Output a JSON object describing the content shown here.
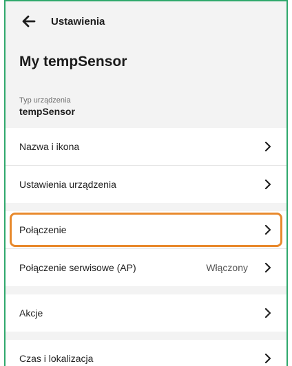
{
  "header": {
    "back_icon": "arrow-left-icon",
    "title": "Ustawienia"
  },
  "device": {
    "name": "My tempSensor",
    "type_label": "Typ urządzenia",
    "type_value": "tempSensor"
  },
  "menu": {
    "items": [
      {
        "label": "Nazwa i ikona"
      },
      {
        "label": "Ustawienia urządzenia"
      },
      {
        "label": "Połączenie",
        "highlighted": true
      },
      {
        "label": "Połączenie serwisowe (AP)",
        "status": "Włączony"
      },
      {
        "label": "Akcje"
      },
      {
        "label": "Czas i lokalizacja"
      }
    ],
    "chevron_icon": "chevron-right-icon"
  },
  "colors": {
    "frame_border": "#2fa86c",
    "highlight_border": "#e8892c",
    "background": "#f3f3f3",
    "row_background": "#ffffff"
  }
}
